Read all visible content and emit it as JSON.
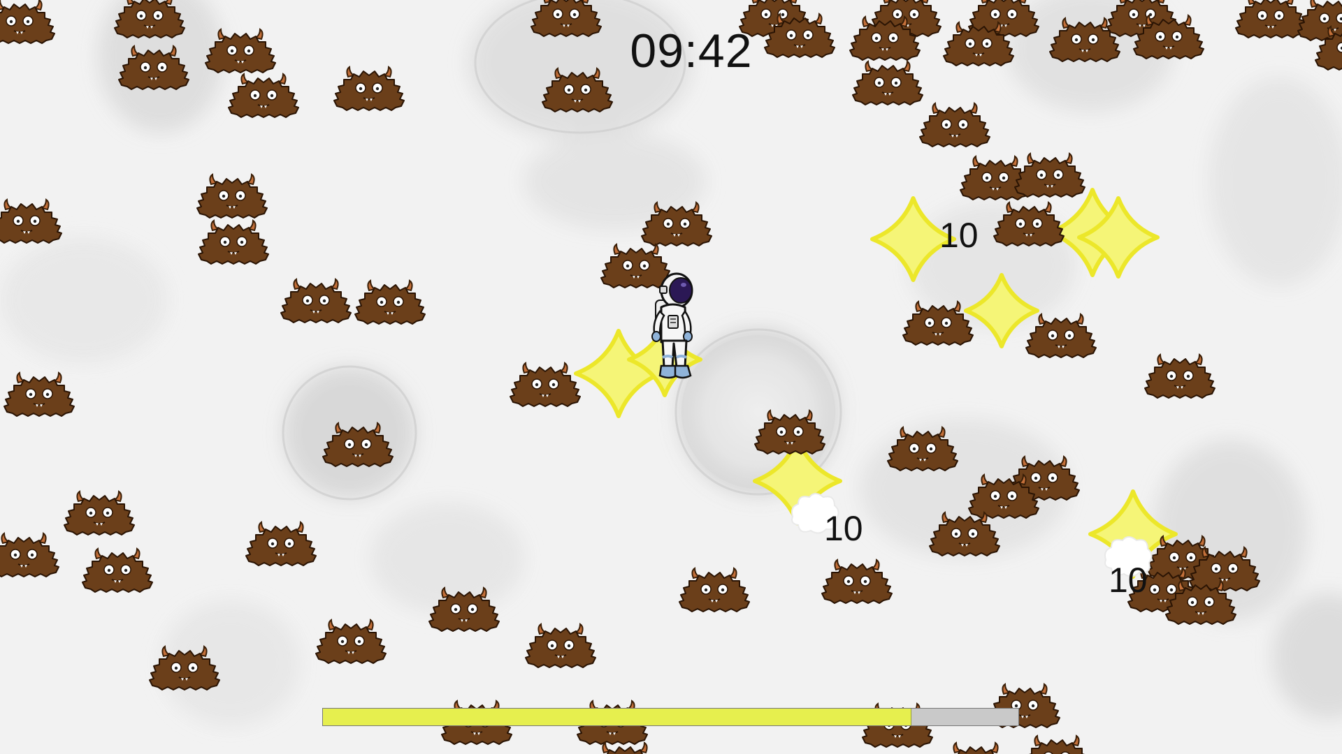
{
  "hud": {
    "timer": "09:42",
    "xp_progress": 0.845
  },
  "floating_damage": [
    "10",
    "10",
    "10"
  ],
  "colors": {
    "monster_fur": "#6b3f1a",
    "monster_horn": "#c4703a",
    "star_fill": "#f5f577",
    "star_stroke": "#ece72a",
    "xp_fill": "#e6ef4e",
    "xp_track": "#c9c9c9"
  },
  "sprites": {
    "player": "astronaut",
    "enemy": "brown-furry-horned-monster",
    "projectile": "yellow-four-point-star",
    "hit_effect": "white-burst"
  }
}
